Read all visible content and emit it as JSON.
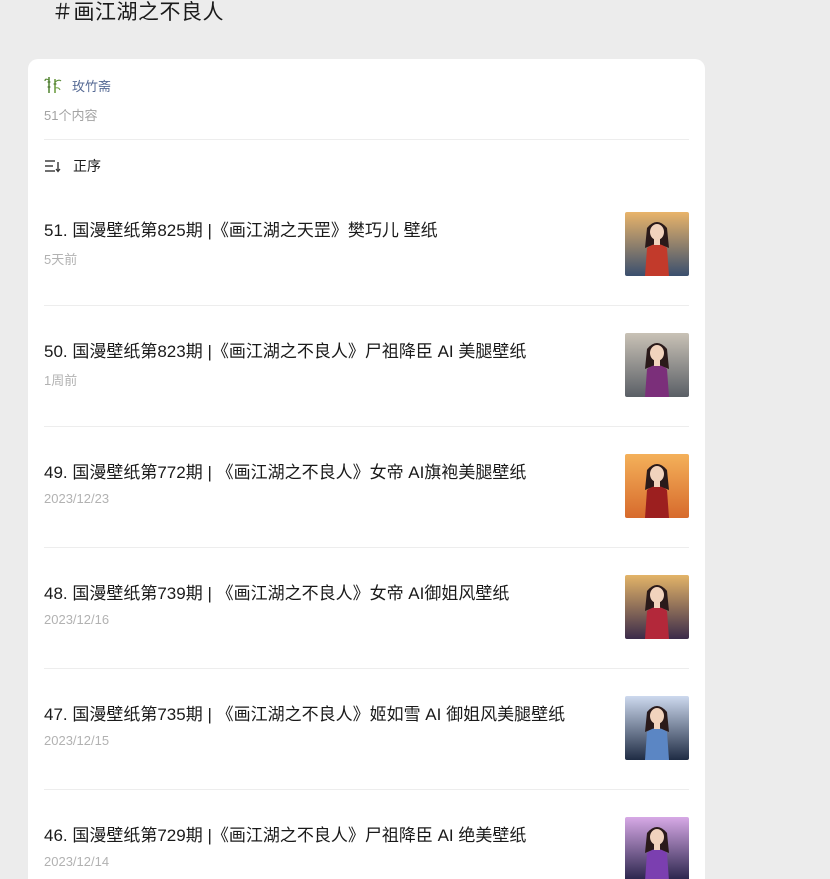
{
  "topic": {
    "title": "＃画江湖之不良人"
  },
  "account": {
    "name": "玫竹斋",
    "avatar_icon": "bamboo-avatar-icon",
    "content_count": "51个内容"
  },
  "sort": {
    "label": "正序",
    "icon": "sort-order-icon"
  },
  "items": [
    {
      "title": "51. 国漫壁纸第825期 |《画江湖之天罡》樊巧儿 壁纸",
      "date": "5天前",
      "thumb": {
        "bg": "#3a4f6e",
        "accent": "#c23a2b",
        "glow": "#e9b46a"
      }
    },
    {
      "title": "50. 国漫壁纸第823期 |《画江湖之不良人》尸祖降臣 AI 美腿壁纸",
      "date": "1周前",
      "thumb": {
        "bg": "#5a5f66",
        "accent": "#7b2f7a",
        "glow": "#c9c2b6"
      }
    },
    {
      "title": "49. 国漫壁纸第772期 | 《画江湖之不良人》女帝 AI旗袍美腿壁纸",
      "date": "2023/12/23",
      "thumb": {
        "bg": "#d76a2c",
        "accent": "#9c1f1f",
        "glow": "#f4b15a"
      }
    },
    {
      "title": "48. 国漫壁纸第739期 | 《画江湖之不良人》女帝 AI御姐风壁纸",
      "date": "2023/12/16",
      "thumb": {
        "bg": "#3b2b4a",
        "accent": "#b3283a",
        "glow": "#e3b468"
      }
    },
    {
      "title": "47. 国漫壁纸第735期 | 《画江湖之不良人》姬如雪 AI 御姐风美腿壁纸",
      "date": "2023/12/15",
      "thumb": {
        "bg": "#1f2c44",
        "accent": "#5b86c4",
        "glow": "#cdd9ee"
      }
    },
    {
      "title": "46. 国漫壁纸第729期 |《画江湖之不良人》尸祖降臣 AI 绝美壁纸",
      "date": "2023/12/14",
      "thumb": {
        "bg": "#28234a",
        "accent": "#7b3fb0",
        "glow": "#d7a9e6"
      }
    }
  ]
}
